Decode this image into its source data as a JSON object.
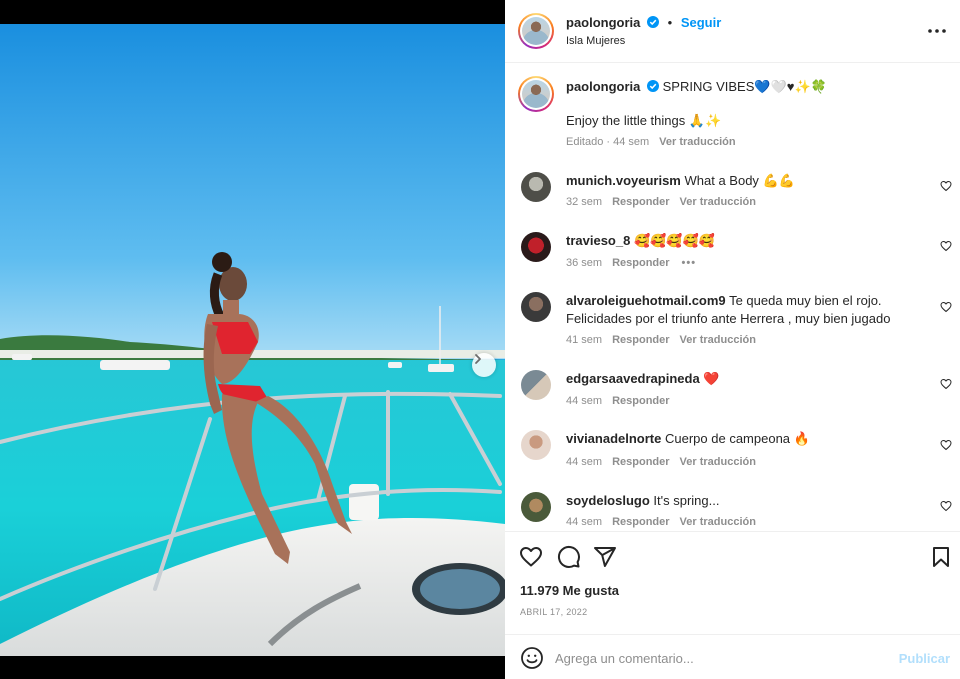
{
  "post": {
    "username": "paolongoria",
    "follow_label": "Seguir",
    "separator": "•",
    "location": "Isla Mujeres",
    "more_icon": "more-horizontal-icon"
  },
  "caption": {
    "username": "paolongoria",
    "line1": "SPRING VIBES💙🤍♥✨🍀",
    "line2": "Enjoy the little things 🙏✨",
    "edited": "Editado · 44 sem",
    "translate": "Ver traducción"
  },
  "comments": [
    {
      "user": "munich.voyeurism",
      "text": "What a Body 💪💪",
      "time": "32 sem",
      "reply": "Responder",
      "translate": "Ver traducción"
    },
    {
      "user": "travieso_8",
      "text": "🥰🥰🥰🥰🥰",
      "time": "36 sem",
      "reply": "Responder",
      "more": "•••"
    },
    {
      "user": "alvaroleiguehotmail.com9",
      "text": "Te queda muy bien el rojo.",
      "text2": "Felicidades por el triunfo ante Herrera , muy bien jugado",
      "time": "41 sem",
      "reply": "Responder",
      "translate": "Ver traducción"
    },
    {
      "user": "edgarsaavedrapineda",
      "text": "❤️",
      "time": "44 sem",
      "reply": "Responder"
    },
    {
      "user": "vivianadelnorte",
      "text": "Cuerpo de campeona 🔥",
      "time": "44 sem",
      "reply": "Responder",
      "translate": "Ver traducción"
    },
    {
      "user": "soydeloslugo",
      "text": "It's spring...",
      "time": "44 sem",
      "reply": "Responder",
      "translate": "Ver traducción"
    }
  ],
  "actions": {
    "likes": "11.979 Me gusta",
    "date": "ABRIL 17, 2022"
  },
  "add_comment": {
    "placeholder": "Agrega un comentario...",
    "publish": "Publicar"
  },
  "carousel": {
    "slides": 2,
    "current": 1
  },
  "colors": {
    "accent": "#0095f6",
    "muted": "#8e8e8e",
    "publish_disabled": "#b2dffc",
    "text": "#262626"
  }
}
